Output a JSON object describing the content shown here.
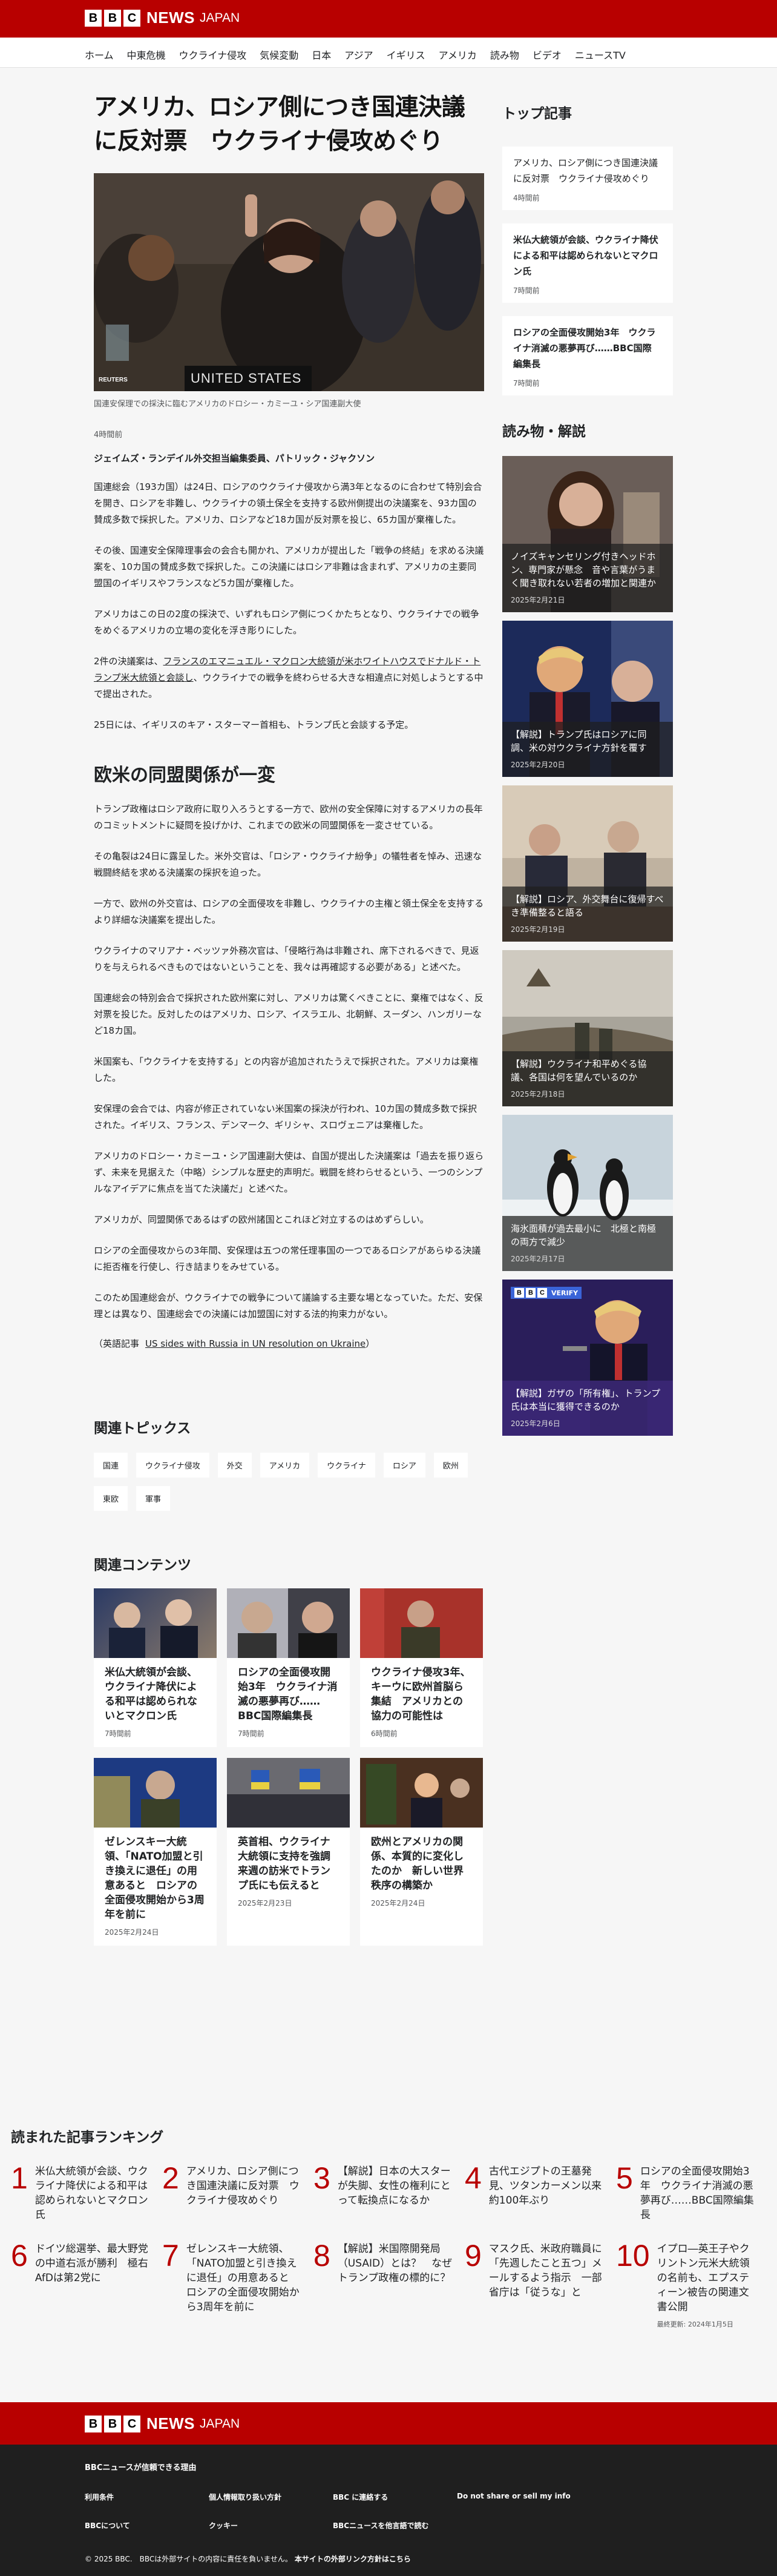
{
  "brand": {
    "letters": [
      "B",
      "B",
      "C"
    ],
    "news": "NEWS",
    "edition": "JAPAN"
  },
  "nav": [
    "ホーム",
    "中東危機",
    "ウクライナ侵攻",
    "気候変動",
    "日本",
    "アジア",
    "イギリス",
    "アメリカ",
    "読み物",
    "ビデオ",
    "ニュースTV"
  ],
  "article": {
    "headline": "アメリカ、ロシア側につき国連決議に反対票　ウクライナ侵攻めぐり",
    "hero_credit": "REUTERS",
    "hero_sign": "UNITED STATES",
    "caption": "国連安保理での採決に臨むアメリカのドロシー・カミーユ・シア国連副大使",
    "timestamp": "4時間前",
    "byline": "ジェイムズ・ランデイル外交担当編集委員、パトリック・ジャクソン",
    "paragraphs_a": [
      "国連総会（193カ国）は24日、ロシアのウクライナ侵攻から満3年となるのに合わせて特別会合を開き、ロシアを非難し、ウクライナの領土保全を支持する欧州側提出の決議案を、93カ国の賛成多数で採択した。アメリカ、ロシアなど18カ国が反対票を投じ、65カ国が棄権した。",
      "その後、国連安全保障理事会の会合も開かれ、アメリカが提出した「戦争の終結」を求める決議案を、10カ国の賛成多数で採択した。この決議にはロシア非難は含まれず、アメリカの主要同盟国のイギリスやフランスなど5カ国が棄権した。",
      "アメリカはこの日の2度の採決で、いずれもロシア側につくかたちとなり、ウクライナでの戦争をめぐるアメリカの立場の変化を浮き彫りにした。"
    ],
    "para4_pre": "2件の決議案は、",
    "para4_link": "フランスのエマニュエル・マクロン大統領が米ホワイトハウスでドナルド・トランプ米大統領と会談し",
    "para4_post": "、ウクライナでの戦争を終わらせる大きな相違点に対処しようとする中で提出された。",
    "para5": "25日には、イギリスのキア・スターマー首相も、トランプ氏と会談する予定。",
    "subheading": "欧米の同盟関係が一変",
    "paragraphs_b": [
      "トランプ政権はロシア政府に取り入ろうとする一方で、欧州の安全保障に対するアメリカの長年のコミットメントに疑問を投げかけ、これまでの欧米の同盟関係を一変させている。",
      "その亀裂は24日に露呈した。米外交官は、「ロシア・ウクライナ紛争」の犠牲者を悼み、迅速な戦闘終結を求める決議案の採択を迫った。",
      "一方で、欧州の外交官は、ロシアの全面侵攻を非難し、ウクライナの主権と領土保全を支持するより詳細な決議案を提出した。",
      "ウクライナのマリアナ・ベッツァ外務次官は、「侵略行為は非難され、席下されるべきで、見返りを与えられるべきものではないということを、我々は再確認する必要がある」と述べた。",
      "国連総会の特別会合で採択された欧州案に対し、アメリカは驚くべきことに、棄権ではなく、反対票を投じた。反対したのはアメリカ、ロシア、イスラエル、北朝鮮、スーダン、ハンガリーなど18カ国。",
      "米国案も、「ウクライナを支持する」との内容が追加されたうえで採択された。アメリカは棄権した。",
      "安保理の会合では、内容が修正されていない米国案の採決が行われ、10カ国の賛成多数で採択された。イギリス、フランス、デンマーク、ギリシャ、スロヴェニアは棄権した。",
      "アメリカのドロシー・カミーユ・シア国連副大使は、自国が提出した決議案は「過去を振り返らず、未来を見据えた（中略）シンプルな歴史的声明だ。戦闘を終わらせるという、一つのシンプルなアイデアに焦点を当てた決議だ」と述べた。",
      "アメリカが、同盟関係であるはずの欧州諸国とこれほど対立するのはめずらしい。",
      "ロシアの全面侵攻からの3年間、安保理は五つの常任理事国の一つであるロシアがあらゆる決議に拒否権を行使し、行き詰まりをみせている。",
      "このため国連総会が、ウクライナでの戦争について議論する主要な場となっていた。ただ、安保理とは異なり、国連総会での決議には加盟国に対する法的拘束力がない。"
    ],
    "ref_label": "（英語記事",
    "ref_link": "US sides with Russia in UN resolution on Ukraine",
    "ref_close": "）"
  },
  "topics": {
    "heading": "関連トピックス",
    "items": [
      "国連",
      "ウクライナ侵攻",
      "外交",
      "アメリカ",
      "ウクライナ",
      "ロシア",
      "欧州",
      "東欧",
      "軍事"
    ]
  },
  "related": {
    "heading": "関連コンテンツ",
    "items": [
      {
        "title": "米仏大統領が会談、ウクライナ降伏による和平は認められないとマクロン氏",
        "date": "7時間前"
      },
      {
        "title": "ロシアの全面侵攻開始3年　ウクライナ消滅の悪夢再び……BBC国際編集長",
        "date": "7時間前"
      },
      {
        "title": "ウクライナ侵攻3年、キーウに欧州首脳ら集結　アメリカとの協力の可能性は",
        "date": "6時間前"
      },
      {
        "title": "ゼレンスキー大統領、「NATO加盟と引き換えに退任」の用意あると　ロシアの全面侵攻開始から3周年を前に",
        "date": "2025年2月24日"
      },
      {
        "title": "英首相、ウクライナ大統領に支持を強調　来週の訪米でトランプ氏にも伝えると",
        "date": "2025年2月23日"
      },
      {
        "title": "欧州とアメリカの関係、本質的に変化したのか　新しい世界秩序の構築か",
        "date": "2025年2月24日"
      }
    ]
  },
  "sidebar": {
    "top_heading": "トップ記事",
    "top": [
      {
        "title": "アメリカ、ロシア側につき国連決議に反対票　ウクライナ侵攻めぐり",
        "date": "4時間前"
      },
      {
        "title": "米仏大統領が会談、ウクライナ降伏による和平は認められないとマクロン氏",
        "date": "7時間前"
      },
      {
        "title": "ロシアの全面侵攻開始3年　ウクライナ消滅の悪夢再び……BBC国際編集長",
        "date": "7時間前"
      }
    ],
    "read_heading": "読み物・解説",
    "verify_label": "VERIFY",
    "read": [
      {
        "title": "ノイズキャンセリング付きヘッドホン、専門家が懸念　音や言葉がうまく聞き取れない若者の増加と関連か",
        "date": "2025年2月21日"
      },
      {
        "title": "【解説】トランプ氏はロシアに同調、米の対ウクライナ方針を覆す",
        "date": "2025年2月20日"
      },
      {
        "title": "【解説】ロシア、外交舞台に復帰すべき準備整ると語る",
        "date": "2025年2月19日"
      },
      {
        "title": "【解説】ウクライナ和平めぐる協議、各国は何を望んでいるのか",
        "date": "2025年2月18日"
      },
      {
        "title": "海氷面積が過去最小に　北極と南極の両方で減少",
        "date": "2025年2月17日"
      },
      {
        "title": "【解説】ガザの「所有権」、トランプ氏は本当に獲得できるのか",
        "date": "2025年2月6日"
      }
    ]
  },
  "ranking": {
    "heading": "読まれた記事ランキング",
    "items": [
      {
        "n": "1",
        "title": "米仏大統領が会談、ウクライナ降伏による和平は認められないとマクロン氏"
      },
      {
        "n": "2",
        "title": "アメリカ、ロシア側につき国連決議に反対票　ウクライナ侵攻めぐり"
      },
      {
        "n": "3",
        "title": "【解説】日本の大スターが失脚、女性の権利にとって転換点になるか"
      },
      {
        "n": "4",
        "title": "古代エジプトの王墓発見、ツタンカーメン以来約100年ぶり"
      },
      {
        "n": "5",
        "title": "ロシアの全面侵攻開始3年　ウクライナ消滅の悪夢再び……BBC国際編集長"
      },
      {
        "n": "6",
        "title": "ドイツ総選挙、最大野党の中道右派が勝利　極右AfDは第2党に"
      },
      {
        "n": "7",
        "title": "ゼレンスキー大統領、「NATO加盟と引き換えに退任」の用意あると　ロシアの全面侵攻開始から3周年を前に"
      },
      {
        "n": "8",
        "title": "【解説】米国際開発局（USAID）とは？　なぜトランプ政権の標的に？"
      },
      {
        "n": "9",
        "title": "マスク氏、米政府職員に「先週したこと五つ」メールするよう指示　一部省庁は「従うな」と"
      },
      {
        "n": "10",
        "title": "イプロ―英王子やクリントン元米大統領の名前も、エプスティーン被告の関連文書公開"
      }
    ],
    "updated": "最終更新: 2024年1月5日"
  },
  "footer": {
    "trust": "BBCニュースが信頼できる理由",
    "links": [
      "利用条件",
      "個人情報取り扱い方針",
      "BBC に連絡する",
      "Do not share or sell my info",
      "BBCについて",
      "クッキー",
      "BBCニュースを他言語で読む"
    ],
    "copyright": "© 2025 BBC.　BBCは外部サイトの内容に責任を負いません。",
    "external": "本サイトの外部リンク方針はこちら"
  },
  "colors": {
    "brand_red": "#b80000",
    "verify_blue": "#3a64d8"
  }
}
